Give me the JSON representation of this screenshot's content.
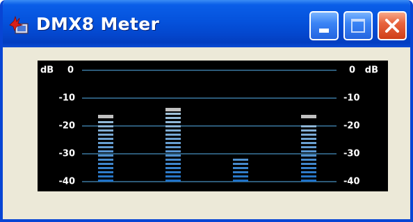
{
  "window": {
    "title": "DMX8 Meter",
    "app_icon": "dmx-meter-app-icon",
    "controls": [
      "minimize-icon",
      "maximize-icon",
      "close-icon"
    ]
  },
  "meter": {
    "unit_left": "dB",
    "unit_right": "dB",
    "scale_labels_left": [
      "0",
      "-10",
      "-20",
      "-30",
      "-40"
    ],
    "scale_labels_right": [
      "0",
      "-10",
      "-20",
      "-30",
      "-40"
    ],
    "scale_values_db": [
      0,
      -10,
      -20,
      -30,
      -40
    ],
    "channels": [
      {
        "level_db": -18,
        "peak_db": -16.5
      },
      {
        "level_db": -15,
        "peak_db": -14
      },
      {
        "level_db": -30.5,
        "peak_db": null
      },
      {
        "level_db": -18.5,
        "peak_db": -16.5
      }
    ],
    "colors": {
      "background": "#000000",
      "gridline": "#2c5a78",
      "segment_top": "#9fc0d8",
      "segment_bottom": "#1f72c8",
      "peak": "#c0c0c0",
      "text": "#ffffff"
    }
  }
}
